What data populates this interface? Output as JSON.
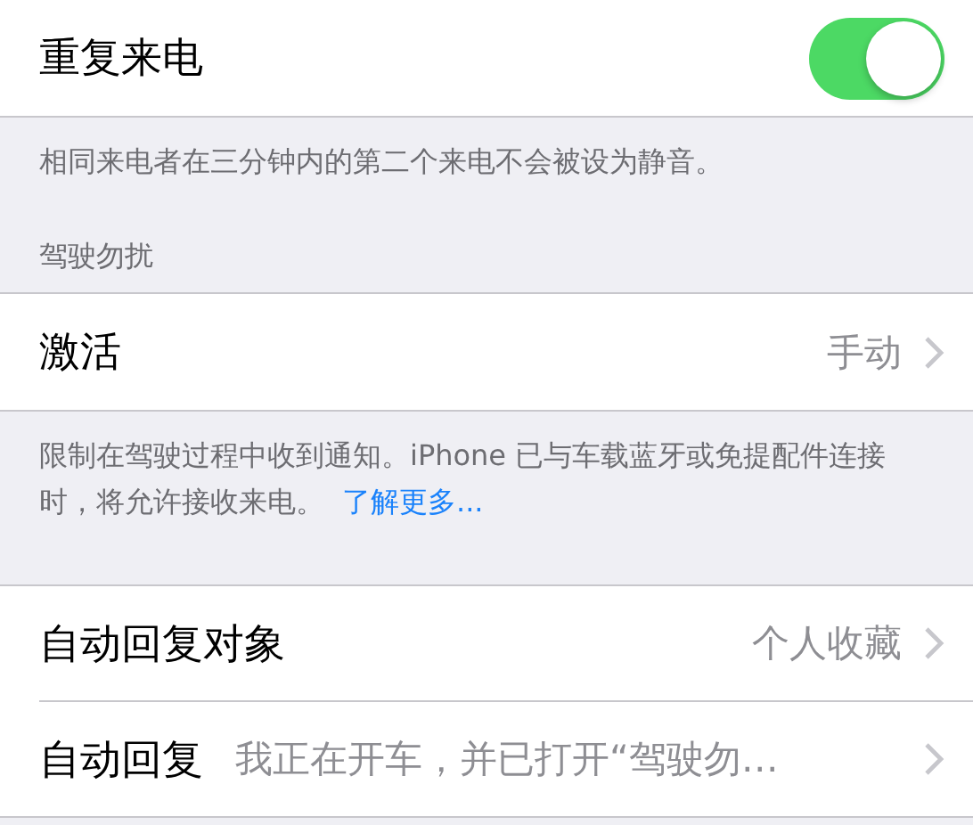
{
  "repeated_calls": {
    "label": "重复来电",
    "on": true
  },
  "repeated_calls_footer": "相同来电者在三分钟内的第二个来电不会被设为静音。",
  "driving_header": "驾驶勿扰",
  "activate": {
    "label": "激活",
    "value": "手动"
  },
  "driving_footer": {
    "text": "限制在驾驶过程中收到通知。iPhone 已与车载蓝牙或免提配件连接时，将允许接收来电。",
    "link": "了解更多..."
  },
  "auto_reply_rows": [
    {
      "label": "自动回复对象",
      "value": "个人收藏"
    },
    {
      "label": "自动回复",
      "value": "我正在开车，并已打开“驾驶勿…"
    }
  ]
}
